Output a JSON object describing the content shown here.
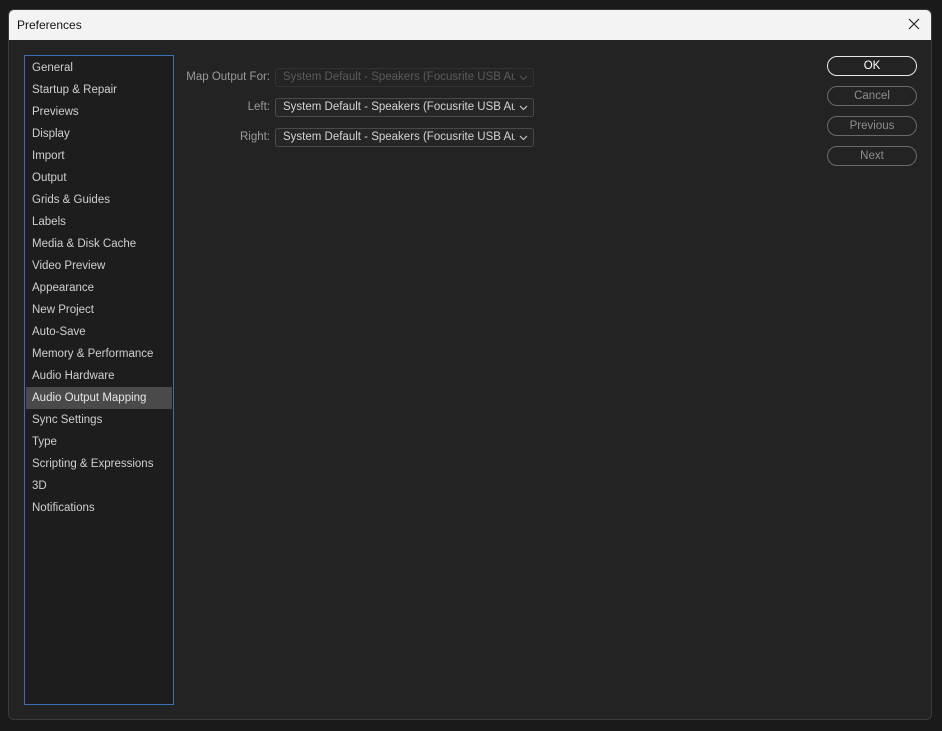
{
  "window": {
    "title": "Preferences"
  },
  "sidebar": {
    "items": [
      {
        "label": "General"
      },
      {
        "label": "Startup & Repair"
      },
      {
        "label": "Previews"
      },
      {
        "label": "Display"
      },
      {
        "label": "Import"
      },
      {
        "label": "Output"
      },
      {
        "label": "Grids & Guides"
      },
      {
        "label": "Labels"
      },
      {
        "label": "Media & Disk Cache"
      },
      {
        "label": "Video Preview"
      },
      {
        "label": "Appearance"
      },
      {
        "label": "New Project"
      },
      {
        "label": "Auto-Save"
      },
      {
        "label": "Memory & Performance"
      },
      {
        "label": "Audio Hardware"
      },
      {
        "label": "Audio Output Mapping"
      },
      {
        "label": "Sync Settings"
      },
      {
        "label": "Type"
      },
      {
        "label": "Scripting & Expressions"
      },
      {
        "label": "3D"
      },
      {
        "label": "Notifications"
      }
    ],
    "selected": "Audio Output Mapping"
  },
  "form": {
    "map_output_for": {
      "label": "Map Output For:",
      "value": "System Default - Speakers (Focusrite USB Au...",
      "disabled": true
    },
    "left": {
      "label": "Left:",
      "value": "System Default - Speakers (Focusrite USB Au..."
    },
    "right": {
      "label": "Right:",
      "value": "System Default - Speakers (Focusrite USB Au..."
    }
  },
  "buttons": {
    "ok": "OK",
    "cancel": "Cancel",
    "previous": "Previous",
    "next": "Next"
  }
}
